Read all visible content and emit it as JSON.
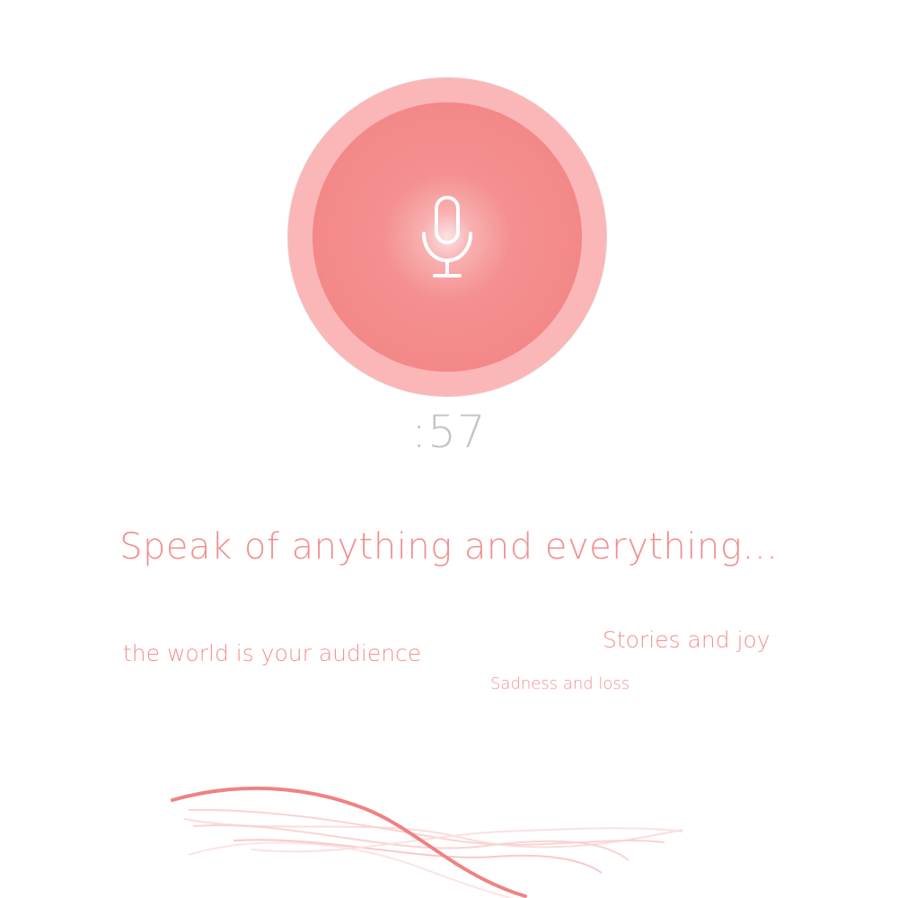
{
  "recorder": {
    "timer": ":57",
    "button_color": "#f38888",
    "ring_color": "#fbb6b7",
    "icon": "microphone-icon"
  },
  "headline": "Speak of anything and everything…",
  "prompts": {
    "world": "the world is your audience",
    "stories": "Stories and joy",
    "sadness": "Sadness and loss"
  },
  "theme": {
    "accent": "#f18f8e",
    "timer_color": "#c4c4c4"
  },
  "waveform": {
    "icon": "audio-waveform"
  }
}
